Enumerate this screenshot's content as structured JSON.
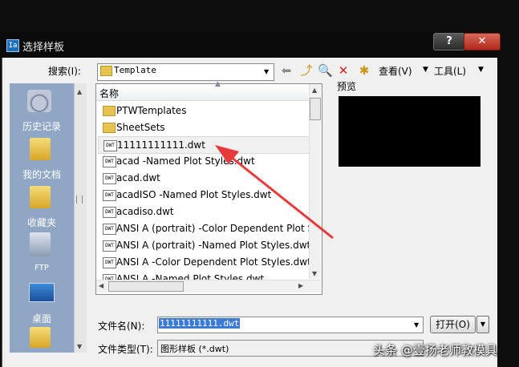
{
  "window": {
    "title": "选择样板",
    "app_icon_text": "Ia",
    "help_label": "?",
    "close_label": "✕"
  },
  "toolbar": {
    "search_label": "搜索(I):",
    "lookin_value": "Template",
    "view_label": "查看(V)",
    "tools_label": "工具(L)",
    "icons": [
      "back-arrow-icon",
      "up-folder-icon",
      "search-web-icon",
      "delete-icon",
      "new-folder-icon"
    ]
  },
  "places": [
    {
      "label": "历史记录",
      "icon": "history-icon"
    },
    {
      "label": "我的文档",
      "icon": "documents-folder-icon"
    },
    {
      "label": "收藏夹",
      "icon": "favorites-folder-icon"
    },
    {
      "label": "FTP",
      "icon": "ftp-icon"
    },
    {
      "label": "桌面",
      "icon": "desktop-icon"
    }
  ],
  "file_list": {
    "column_name": "名称",
    "items": [
      {
        "name": "PTWTemplates",
        "type": "folder"
      },
      {
        "name": "SheetSets",
        "type": "folder"
      },
      {
        "name": "11111111111.dwt",
        "type": "dwt",
        "selected": true
      },
      {
        "name": "acad -Named Plot Styles.dwt",
        "type": "dwt"
      },
      {
        "name": "acad.dwt",
        "type": "dwt"
      },
      {
        "name": "acadISO -Named Plot Styles.dwt",
        "type": "dwt"
      },
      {
        "name": "acadiso.dwt",
        "type": "dwt"
      },
      {
        "name": "ANSI A (portrait) -Color Dependent Plot S",
        "type": "dwt"
      },
      {
        "name": "ANSI A (portrait) -Named Plot Styles.dwt",
        "type": "dwt"
      },
      {
        "name": "ANSI A -Color Dependent Plot Styles.dwt",
        "type": "dwt"
      },
      {
        "name": "ANSI A -Named Plot Styles.dwt",
        "type": "dwt"
      }
    ]
  },
  "preview": {
    "label": "预览"
  },
  "bottom": {
    "filename_label": "文件名(N):",
    "filename_value": "11111111111.dwt",
    "open_label": "打开(O)",
    "filetype_label": "文件类型(T):",
    "filetype_value": "图形样板 (*.dwt)"
  },
  "watermark": "头条 @壹扬老师教模具",
  "colors": {
    "places_bg": "#8fa6c4",
    "selection": "#3d7ad6",
    "annotation_arrow": "#e83a3a"
  }
}
